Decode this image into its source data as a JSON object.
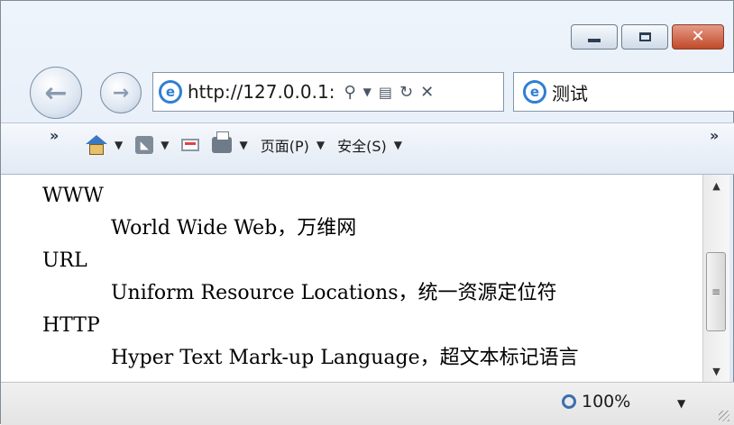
{
  "window": {
    "caption_buttons": [
      "minimize",
      "maximize",
      "close"
    ]
  },
  "nav": {
    "address_url": "http://127.0.0.1:",
    "address_tools": [
      "search-icon",
      "dropdown",
      "compat-icon",
      "refresh-icon",
      "stop-icon"
    ],
    "tab_title": "测试"
  },
  "commandbar": {
    "overflow_left": "»",
    "overflow_right": "»",
    "page_menu": "页面(P)",
    "safety_menu": "安全(S)"
  },
  "content": {
    "items": [
      {
        "term": "WWW",
        "desc": "World Wide Web，万维网"
      },
      {
        "term": "URL",
        "desc": "Uniform Resource Locations，统一资源定位符"
      },
      {
        "term": "HTTP",
        "desc": "Hyper Text Mark-up Language，超文本标记语言"
      }
    ]
  },
  "status": {
    "zoom": "100%"
  }
}
